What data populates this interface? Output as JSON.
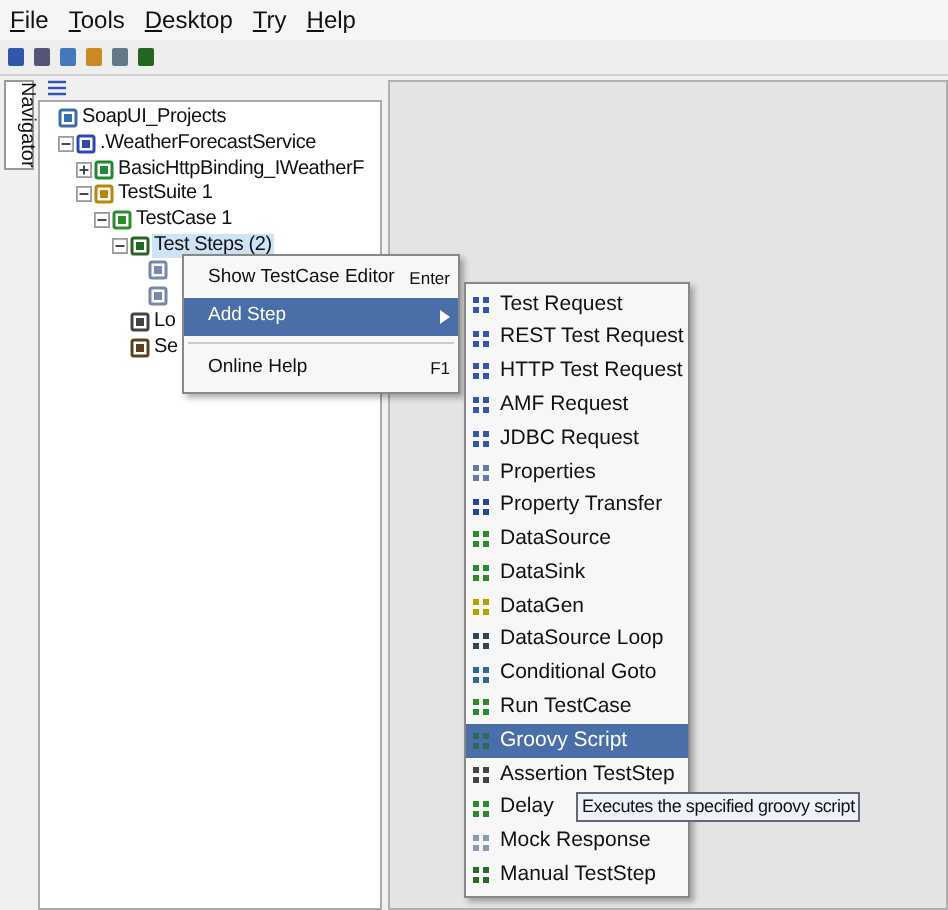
{
  "menu_bar": [
    "File",
    "Tools",
    "Desktop",
    "Try",
    "Help"
  ],
  "side_tab": {
    "label": "Navigator",
    "selected": true
  },
  "tree": [
    {
      "label": "SoapUI_Projects",
      "kind": "workspace",
      "children": [
        {
          "label": ".WeatherForecastService",
          "kind": "project",
          "expanded": true,
          "children": [
            {
              "label": "BasicHttpBinding_IWeatherF",
              "kind": "interface",
              "expanded": false
            },
            {
              "label": "TestSuite 1",
              "kind": "suite",
              "expanded": true,
              "children": [
                {
                  "label": "TestCase 1",
                  "kind": "case",
                  "expanded": true,
                  "children": [
                    {
                      "label": "Test Steps (2)",
                      "kind": "steps",
                      "expanded": true,
                      "selected": true,
                      "children": [
                        {
                          "kind": "step"
                        },
                        {
                          "kind": "step"
                        }
                      ]
                    },
                    {
                      "label": "Lo",
                      "kind": "load"
                    },
                    {
                      "label": "Se",
                      "kind": "security"
                    }
                  ]
                }
              ]
            }
          ]
        }
      ]
    }
  ],
  "context_menu": [
    {
      "label": "Show TestCase Editor",
      "shortcut": "Enter",
      "kind": "item",
      "selected": false
    },
    {
      "label": "Add Step",
      "kind": "submenu",
      "selected": true
    },
    {
      "kind": "separator"
    },
    {
      "label": "Online Help",
      "shortcut": "F1",
      "kind": "item",
      "selected": false
    }
  ],
  "add_step_menu": [
    {
      "label": "Test Request",
      "selected": false
    },
    {
      "label": "REST Test Request",
      "selected": false
    },
    {
      "label": "HTTP Test Request",
      "selected": false
    },
    {
      "label": "AMF Request",
      "selected": false
    },
    {
      "label": "JDBC Request",
      "selected": false
    },
    {
      "label": "Properties",
      "selected": false
    },
    {
      "label": "Property Transfer",
      "selected": false
    },
    {
      "label": "DataSource",
      "selected": false
    },
    {
      "label": "DataSink",
      "selected": false
    },
    {
      "label": "DataGen",
      "selected": false
    },
    {
      "label": "DataSource Loop",
      "selected": false
    },
    {
      "label": "Conditional Goto",
      "selected": false
    },
    {
      "label": "Run TestCase",
      "selected": false
    },
    {
      "label": "Groovy Script",
      "selected": true
    },
    {
      "label": "Assertion TestStep",
      "selected": false
    },
    {
      "label": "Delay",
      "selected": false
    },
    {
      "label": "Mock Response",
      "selected": false
    },
    {
      "label": "Manual TestStep",
      "selected": false
    }
  ],
  "tooltip": "Executes the specified groovy script"
}
